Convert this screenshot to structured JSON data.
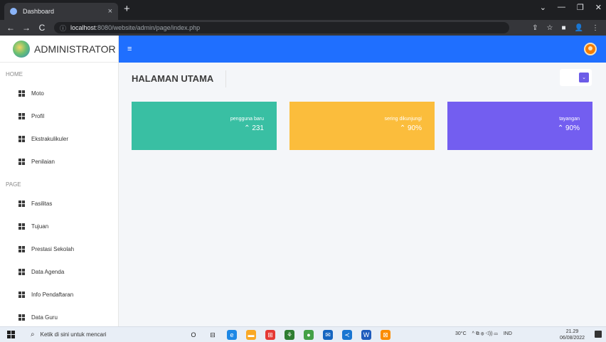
{
  "browser": {
    "tab_title": "Dashboard",
    "tab_close": "×",
    "new_tab": "+",
    "url_host": "localhost",
    "url_rest": ":8080/website/admin/page/index.php",
    "win_controls": [
      "⌄",
      "—",
      "❐",
      "✕"
    ],
    "nav": [
      "←",
      "→",
      "C"
    ],
    "omni_icons": [
      "⇪",
      "☆",
      "■",
      "👤",
      "⋮"
    ]
  },
  "sidebar": {
    "brand": "ADMINISTRATOR",
    "sections": [
      {
        "title": "HOME",
        "items": [
          "Moto",
          "Profil",
          "Ekstrakulikuler",
          "Penilaian"
        ]
      },
      {
        "title": "PAGE",
        "items": [
          "Fasilitas",
          "Tujuan",
          "Prestasi Sekolah",
          "Data Agenda",
          "Info Pendaftaran",
          "Data Guru"
        ]
      }
    ]
  },
  "header": {
    "menu_icon": "≡"
  },
  "main": {
    "title": "HALAMAN UTAMA",
    "dropdown_caret": "⌄",
    "cards": [
      {
        "label": "pengguna baru",
        "value": "⌃ 231",
        "color": "#39bfa3"
      },
      {
        "label": "sering dikunjungi",
        "value": "⌃ 90%",
        "color": "#fbbd3c"
      },
      {
        "label": "tayangan",
        "value": "⌃ 90%",
        "color": "#735ef0"
      }
    ]
  },
  "taskbar": {
    "search_placeholder": "Ketik di sini untuk mencari",
    "apps": [
      "cortana-icon",
      "task-view-icon",
      "edge-icon",
      "file-explorer-icon",
      "store-icon",
      "teams-icon",
      "chrome-icon",
      "mail-icon",
      "vscode-icon",
      "word-icon",
      "xampp-icon"
    ],
    "weather": "30°C",
    "tray_icons": "^ ⧉ ⊕ ◁)) ▭",
    "lang": "IND",
    "time": "21.29",
    "date": "06/08/2022"
  },
  "colors": {
    "primary": "#1f6fff",
    "accent": "#6c5ce7"
  }
}
